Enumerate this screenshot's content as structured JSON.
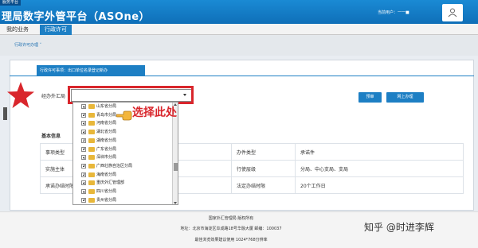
{
  "header": {
    "badge": "服务平台",
    "title": "理局数字外管平台（ASOne）",
    "user_label": "当前用户：",
    "user_name": "一一■"
  },
  "nav": {
    "tabs": [
      {
        "label": "我的业务",
        "active": false
      },
      {
        "label": "行政许可",
        "active": true
      }
    ]
  },
  "breadcrumb": "行政许可办理 ˅",
  "panel_tab": "行政许可事项：出口单位名录登记新办",
  "form": {
    "field_label": "经办外汇局",
    "select_value": "",
    "preview_button": "预审",
    "online_button": "网上办理"
  },
  "annotation": "选择此处",
  "dropdown": {
    "items": [
      "山东省分局",
      "青岛市分局",
      "河南省分局",
      "湖北省分局",
      "湖南省分局",
      "广东省分局",
      "深圳市分局",
      "广西壮族自治区分局",
      "海南省分局",
      "重庆外汇管理部",
      "四川省分局",
      "贵州省分局"
    ]
  },
  "section": {
    "title": "基本信息"
  },
  "info_table": {
    "rows": [
      [
        "事项类型",
        "",
        "办件类型",
        "承诺件"
      ],
      [
        "实施主体",
        "",
        "行使层级",
        "分局、中心支局、支局"
      ],
      [
        "承诺办结时限",
        "",
        "法定办结时限",
        "20个工作日"
      ]
    ]
  },
  "footer": {
    "line1": "国家外汇管理局 版权所有",
    "line2": "地址：北京市海淀区阜成路18号华融大厦 邮编：100037",
    "line3": "最佳浏览效果建议使用 1024*768分辨率"
  },
  "watermark": "知乎 @时进李辉",
  "colors": {
    "accent": "#1d7fc4",
    "highlight": "#d9262c"
  }
}
